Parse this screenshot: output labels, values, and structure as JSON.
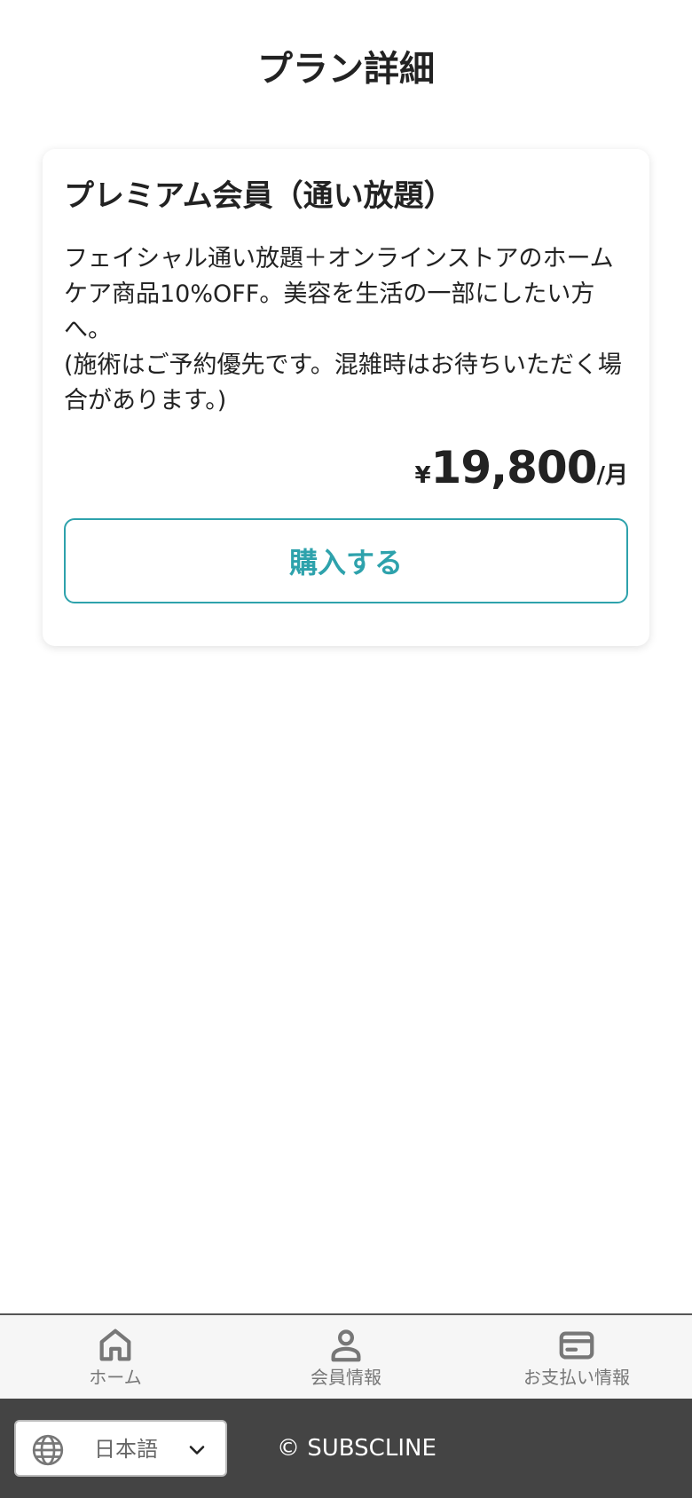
{
  "header": {
    "title": "プラン詳細"
  },
  "plan": {
    "name": "プレミアム会員（通い放題）",
    "description": "フェイシャル通い放題＋オンラインストアのホームケア商品10%OFF。美容を生活の一部にしたい方へ。\n(施術はご予約優先です。混雑時はお待ちいただく場合があります。)",
    "price": {
      "currency": "¥",
      "amount": "19,800",
      "unit": "/月"
    },
    "purchase_label": "購入する"
  },
  "nav": {
    "items": [
      {
        "label": "ホーム",
        "icon": "home-icon"
      },
      {
        "label": "会員情報",
        "icon": "person-icon"
      },
      {
        "label": "お支払い情報",
        "icon": "credit-card-icon"
      }
    ]
  },
  "footer": {
    "language": "日本語",
    "copyright": "© SUBSCLINE"
  },
  "colors": {
    "accent": "#2ea2ac",
    "footer_bg": "#444444",
    "nav_bg": "#f6f6f6",
    "nav_text": "#777777"
  }
}
